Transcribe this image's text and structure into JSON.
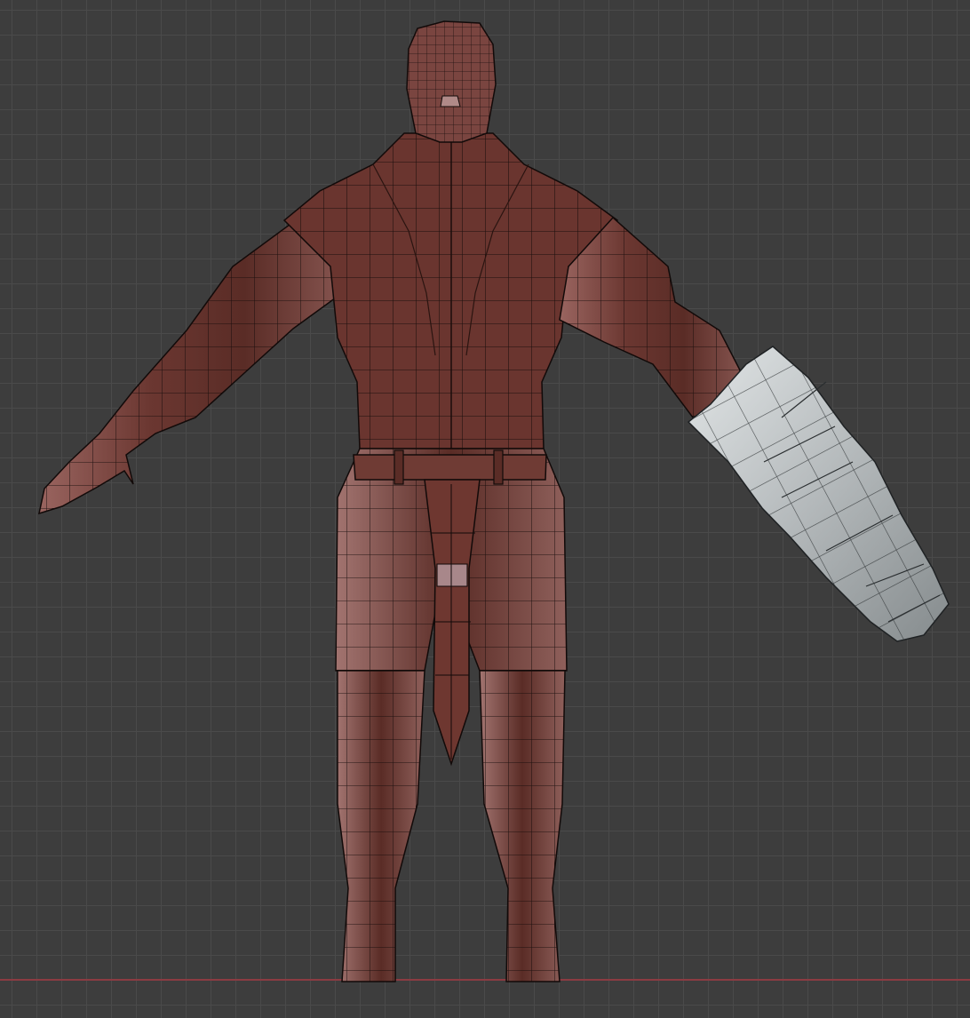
{
  "viewport": {
    "view": "back-orthographic",
    "shading": "solid",
    "overlay": "wireframe",
    "grid": true,
    "axis_line": "x-axis"
  },
  "model": {
    "body_parts": [
      "head",
      "torso",
      "left-arm",
      "right-arm-stone-gauntlet",
      "belt",
      "tail",
      "left-leg",
      "right-leg"
    ],
    "colors": {
      "background": "#3d3d3d",
      "grid_minor": "#4a4a4a",
      "grid_major": "#535353",
      "skin": "#6e3a33",
      "skin_shadow": "#4a2520",
      "skin_light": "#9a6560",
      "stone": "#b5b9bb",
      "stone_light": "#dfe3e4",
      "stone_dark": "#7f8587",
      "wire": "#111111",
      "x_axis": "#8c3b42"
    }
  }
}
